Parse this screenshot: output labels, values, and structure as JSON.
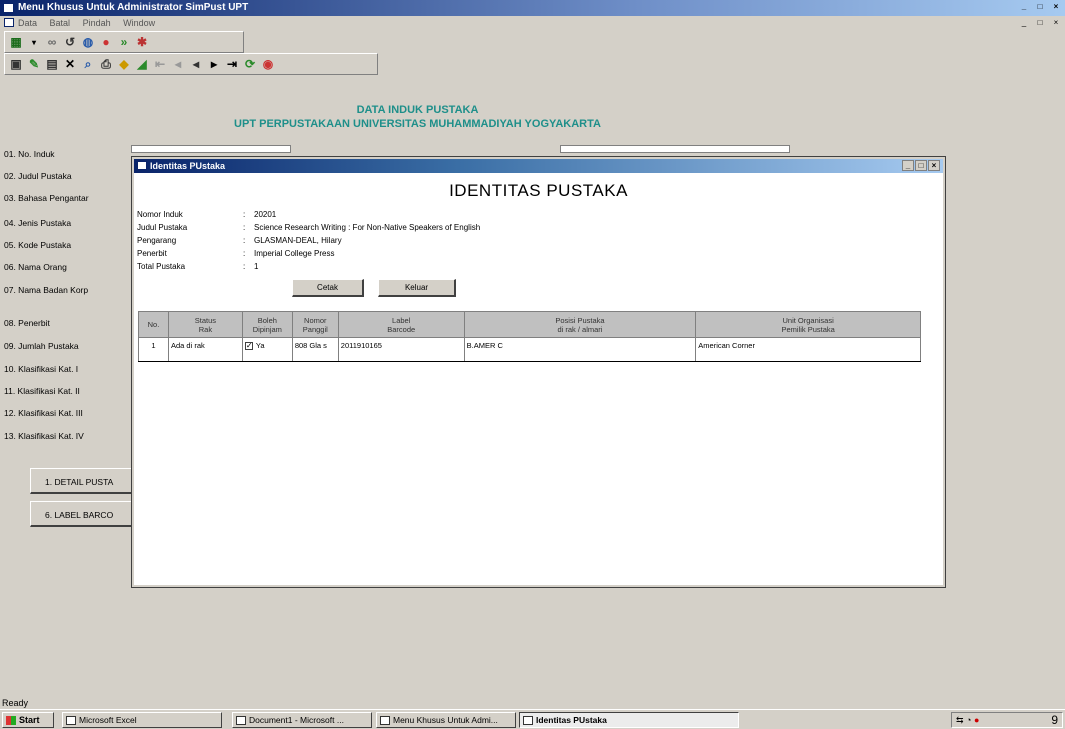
{
  "window": {
    "title": "Menu Khusus Untuk Administrator SimPust UPT",
    "controls": [
      "_",
      "□",
      "×"
    ]
  },
  "menubar": {
    "items": [
      "Data",
      "Batal",
      "Pindah",
      "Window"
    ]
  },
  "header": {
    "line1": "DATA INDUK PUSTAKA",
    "line2": "UPT PERPUSTAKAAN UNIVERSITAS MUHAMMADIYAH YOGYAKARTA"
  },
  "form_fields": [
    "01. No. Induk",
    "02. Judul Pustaka",
    "03. Bahasa Pengantar",
    "04. Jenis Pustaka",
    "05. Kode Pustaka",
    "06. Nama Orang",
    "07. Nama Badan Korp",
    "08. Penerbit",
    "09. Jumlah Pustaka",
    "10. Klasifikasi Kat. I",
    "11. Klasifikasi Kat. II",
    "12. Klasifikasi Kat. III",
    "13. Klasifikasi Kat. IV"
  ],
  "side_buttons": [
    "1. DETAIL PUSTA",
    "6. LABEL BARCO"
  ],
  "dialog": {
    "title": "Identitas PUstaka",
    "heading": "IDENTITAS PUSTAKA",
    "info": [
      {
        "label": "Nomor Induk",
        "value": "20201"
      },
      {
        "label": "Judul Pustaka",
        "value": "Science Research Writing : For Non-Native Speakers of English"
      },
      {
        "label": "Pengarang",
        "value": "GLASMAN-DEAL, Hilary"
      },
      {
        "label": "Penerbit",
        "value": "Imperial College Press"
      },
      {
        "label": "Total Pustaka",
        "value": "1"
      }
    ],
    "colon": ":",
    "buttons": {
      "print": "Cetak",
      "exit": "Keluar"
    },
    "table": {
      "headers": [
        "No.",
        "Status\nRak",
        "Boleh\nDipinjam",
        "Nomor\nPanggil",
        "Label\nBarcode",
        "Posisi Pustaka\ndi rak / almari",
        "Unit Organisasi\nPemilik Pustaka"
      ],
      "rows": [
        {
          "no": "1",
          "status": "Ada di rak",
          "boleh": "Ya",
          "nomor": "808 Gla s",
          "barcode": "2011910165",
          "posisi": "B.AMER C",
          "unit": "American Corner"
        }
      ]
    }
  },
  "status_bar": {
    "text": "Ready"
  },
  "taskbar": {
    "start": "Start",
    "tasks": [
      "Microsoft Excel",
      "Document1 - Microsoft ...",
      "Menu Khusus Untuk Admi...",
      "Identitas PUstaka"
    ],
    "clock": "9"
  }
}
